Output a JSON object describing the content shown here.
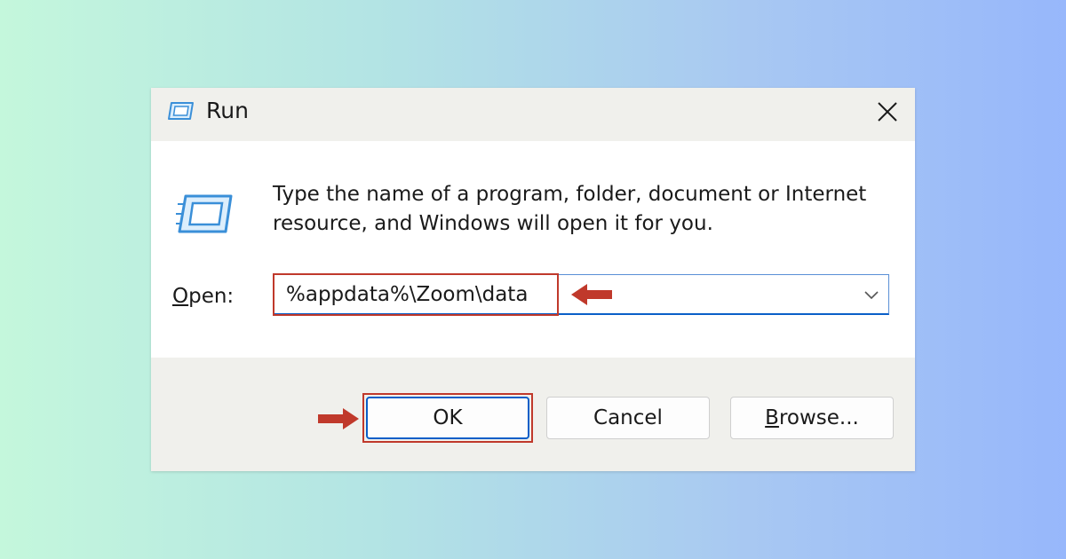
{
  "dialog": {
    "title": "Run",
    "description": "Type the name of a program, folder, document or Internet resource, and Windows will open it for you.",
    "open_label_accel": "O",
    "open_label_rest": "pen:",
    "input_value": "%appdata%\\Zoom\\data"
  },
  "buttons": {
    "ok": "OK",
    "cancel": "Cancel",
    "browse_accel": "B",
    "browse_rest": "rowse..."
  },
  "icons": {
    "title": "run-icon",
    "main": "run-icon",
    "close": "close-icon",
    "dropdown": "chevron-down-icon",
    "annotation_left": "arrow-left-icon",
    "annotation_right": "arrow-right-icon"
  },
  "colors": {
    "annotation": "#c0392b",
    "accent": "#0a5fc8",
    "icon_blue": "#3a8fd8"
  }
}
